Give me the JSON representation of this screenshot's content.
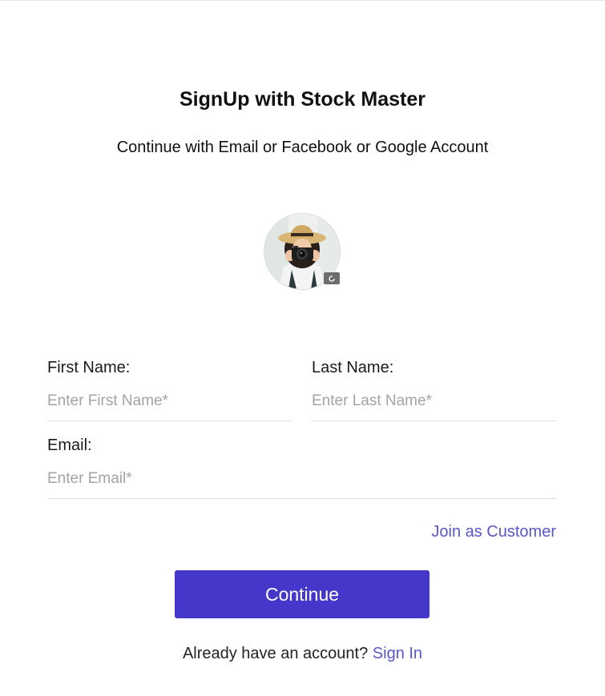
{
  "header": {
    "title": "SignUp with Stock Master",
    "subtitle": "Continue with Email or Facebook or Google Account"
  },
  "avatar": {
    "icon": "camera-photo-avatar",
    "badge_icon": "refresh-icon"
  },
  "form": {
    "first_name": {
      "label": "First Name:",
      "placeholder": "Enter First Name*",
      "value": ""
    },
    "last_name": {
      "label": "Last Name:",
      "placeholder": "Enter Last Name*",
      "value": ""
    },
    "email": {
      "label": "Email:",
      "placeholder": "Enter Email*",
      "value": ""
    }
  },
  "links": {
    "join_customer": "Join as Customer"
  },
  "actions": {
    "continue_label": "Continue"
  },
  "footer": {
    "prompt": "Already have an account?",
    "signin_label": "Sign In"
  },
  "colors": {
    "primary_button": "#4537c9",
    "link": "#5a55c9",
    "placeholder": "#a3a3a3"
  }
}
